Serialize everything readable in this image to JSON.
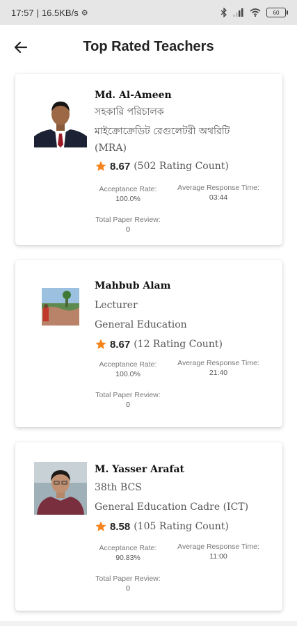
{
  "status_bar": {
    "time": "17:57",
    "speed": "16.5KB/s",
    "battery": "60"
  },
  "app_bar": {
    "title": "Top Rated Teachers",
    "back_icon": "arrow-left-icon"
  },
  "labels": {
    "acceptance": "Acceptance Rate:",
    "response": "Average Response Time:",
    "review": "Total Paper Review:"
  },
  "accent_color": "#f5841f",
  "teachers": [
    {
      "name": "Md. Al-Ameen",
      "line1": "সহকারি পরিচালক",
      "line2": "মাইক্রোক্রেডিট রেগুলেটরী অথরিটি",
      "line3": "(MRA)",
      "rating": "8.67",
      "rating_count": "(502 Rating Count)",
      "acceptance": "100.0%",
      "response_time": "03:44",
      "paper_review": "0"
    },
    {
      "name": "Mahbub Alam",
      "line1": "Lecturer",
      "line2": "General Education",
      "rating": "8.67",
      "rating_count": "(12 Rating Count)",
      "acceptance": "100.0%",
      "response_time": "21:40",
      "paper_review": "0"
    },
    {
      "name": "M. Yasser Arafat",
      "line1": "38th BCS",
      "line2": "General Education Cadre (ICT)",
      "rating": "8.58",
      "rating_count": "(105 Rating Count)",
      "acceptance": "90.83%",
      "response_time": "11:00",
      "paper_review": "0"
    }
  ]
}
